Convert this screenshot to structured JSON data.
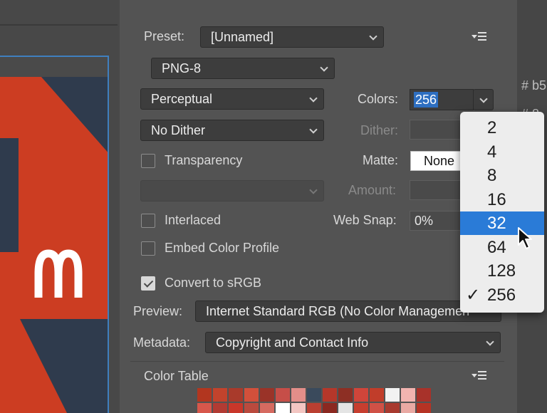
{
  "preset": {
    "label": "Preset:",
    "value": "[Unnamed]"
  },
  "format": {
    "value": "PNG-8"
  },
  "reduction": {
    "value": "Perceptual"
  },
  "colors": {
    "label": "Colors:",
    "value": "256"
  },
  "dither": {
    "value": "No Dither",
    "label": "Dither:"
  },
  "transparency": {
    "label": "Transparency",
    "checked": false
  },
  "matte": {
    "label": "Matte:",
    "value": "None"
  },
  "amount": {
    "label": "Amount:"
  },
  "interlaced": {
    "label": "Interlaced",
    "checked": false
  },
  "web_snap": {
    "label": "Web Snap:",
    "value": "0%"
  },
  "embed_profile": {
    "label": "Embed Color Profile",
    "checked": false
  },
  "convert_srgb": {
    "label": "Convert to sRGB",
    "checked": true
  },
  "preview": {
    "label": "Preview:",
    "value": "Internet Standard RGB (No Color Managemen"
  },
  "metadata": {
    "label": "Metadata:",
    "value": "Copyright and Contact Info"
  },
  "color_table": {
    "label": "Color Table"
  },
  "colors_menu": {
    "options": [
      "2",
      "4",
      "8",
      "16",
      "32",
      "64",
      "128",
      "256"
    ],
    "highlighted": "32",
    "selected": "256",
    "check_glyph": "✓"
  },
  "side_hints": {
    "hex1": "# b5",
    "hex2": "# 8"
  },
  "accent": "#2a7bd7",
  "brand_red": "#cc3d22",
  "logo_yellow": "#ffffff",
  "swatches": [
    "#b2361f",
    "#c2432c",
    "#a93a2b",
    "#d2503b",
    "#9a3328",
    "#c64e48",
    "#e38e89",
    "#3a4a5c",
    "#b5372a",
    "#8d2f24",
    "#d0453a",
    "#c13d2a",
    "#f2f2f2",
    "#f1b4b0",
    "#a8322a",
    "#d7574b",
    "#b23b33",
    "#c9372a",
    "#ba4a3e",
    "#d66a60",
    "#ffffff",
    "#f3c6c2",
    "#ba3f31",
    "#8b2820",
    "#e4e4e4",
    "#c73e2f",
    "#d05146",
    "#a83a2f",
    "#e9a9a3",
    "#b63324"
  ]
}
